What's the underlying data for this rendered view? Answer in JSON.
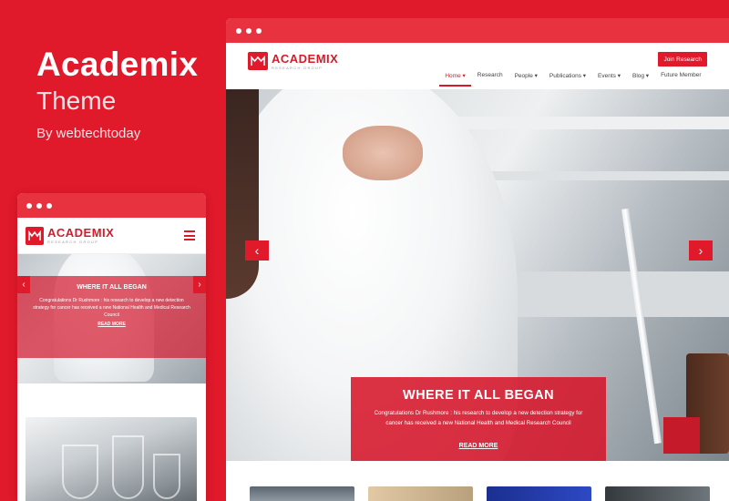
{
  "promo": {
    "title": "Academix",
    "subtitle": "Theme",
    "byline": "By webtechtoday"
  },
  "brand": {
    "name": "ACADEMIX",
    "tagline": "RESEARCH GROUP",
    "color": "#e0192b"
  },
  "desktop": {
    "join_button": "Join Research",
    "nav": [
      {
        "label": "Home ▾"
      },
      {
        "label": "Research"
      },
      {
        "label": "People ▾"
      },
      {
        "label": "Publications ▾"
      },
      {
        "label": "Events ▾"
      },
      {
        "label": "Blog ▾"
      },
      {
        "label": "Future Member"
      }
    ],
    "slide": {
      "title": "WHERE IT ALL BEGAN",
      "text": "Congratulations Dr Rushmore : his research to develop a new detection strategy for cancer has received a new National Health and Medical Research Council",
      "link": "READ MORE"
    }
  },
  "mobile": {
    "slide": {
      "title": "WHERE IT ALL BEGAN",
      "text": "Congratulations Dr Rushmore : his research to develop a new detection strategy for cancer has received a new National Health and Medical Research Council",
      "link": "READ MORE"
    }
  },
  "icons": {
    "prev": "chevron-left-icon",
    "next": "chevron-right-icon",
    "menu": "hamburger-icon"
  }
}
